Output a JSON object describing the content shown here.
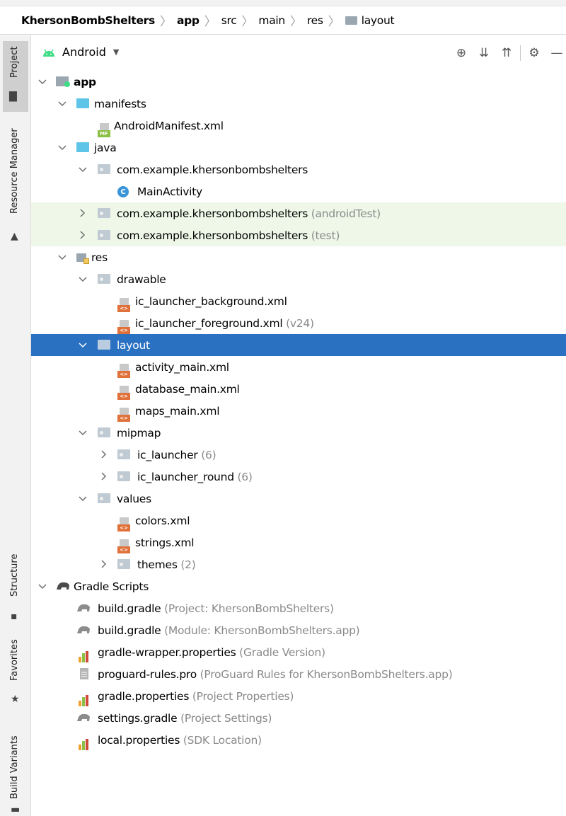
{
  "breadcrumb": {
    "items": [
      "KhersonBombShelters",
      "app",
      "src",
      "main",
      "res",
      "layout"
    ]
  },
  "sidebar": {
    "project_label": "Project",
    "resource_manager_label": "Resource Manager",
    "structure_label": "Structure",
    "favorites_label": "Favorites",
    "build_variants_label": "Build Variants"
  },
  "toolbar": {
    "view_mode": "Android",
    "icons": [
      "locate-icon",
      "expand-all-icon",
      "collapse-all-icon",
      "gear-icon",
      "minimize-icon"
    ]
  },
  "tree": {
    "rows": [
      {
        "label": "app",
        "extra": ""
      },
      {
        "label": "manifests",
        "extra": ""
      },
      {
        "label": "AndroidManifest.xml",
        "extra": ""
      },
      {
        "label": "java",
        "extra": ""
      },
      {
        "label": "com.example.khersonbombshelters",
        "extra": ""
      },
      {
        "label": "MainActivity",
        "extra": ""
      },
      {
        "label": "com.example.khersonbombshelters",
        "extra": " (androidTest)"
      },
      {
        "label": "com.example.khersonbombshelters",
        "extra": " (test)"
      },
      {
        "label": "res",
        "extra": ""
      },
      {
        "label": "drawable",
        "extra": ""
      },
      {
        "label": "ic_launcher_background.xml",
        "extra": ""
      },
      {
        "label": "ic_launcher_foreground.xml",
        "extra": " (v24)"
      },
      {
        "label": "layout",
        "extra": ""
      },
      {
        "label": "activity_main.xml",
        "extra": ""
      },
      {
        "label": "database_main.xml",
        "extra": ""
      },
      {
        "label": "maps_main.xml",
        "extra": ""
      },
      {
        "label": "mipmap",
        "extra": ""
      },
      {
        "label": "ic_launcher",
        "extra": " (6)"
      },
      {
        "label": "ic_launcher_round",
        "extra": " (6)"
      },
      {
        "label": "values",
        "extra": ""
      },
      {
        "label": "colors.xml",
        "extra": ""
      },
      {
        "label": "strings.xml",
        "extra": ""
      },
      {
        "label": "themes",
        "extra": " (2)"
      },
      {
        "label": "Gradle Scripts",
        "extra": ""
      },
      {
        "label": "build.gradle",
        "extra": " (Project: KhersonBombShelters)"
      },
      {
        "label": "build.gradle",
        "extra": " (Module: KhersonBombShelters.app)"
      },
      {
        "label": "gradle-wrapper.properties",
        "extra": " (Gradle Version)"
      },
      {
        "label": "proguard-rules.pro",
        "extra": " (ProGuard Rules for KhersonBombShelters.app)"
      },
      {
        "label": "gradle.properties",
        "extra": " (Project Properties)"
      },
      {
        "label": "settings.gradle",
        "extra": " (Project Settings)"
      },
      {
        "label": "local.properties",
        "extra": " (SDK Location)"
      }
    ]
  },
  "colors": {
    "selection": "#2a71c2",
    "test_highlight": "#eff7e8",
    "secondary_text": "#8a8a8a",
    "android_green": "#3ddc84"
  }
}
